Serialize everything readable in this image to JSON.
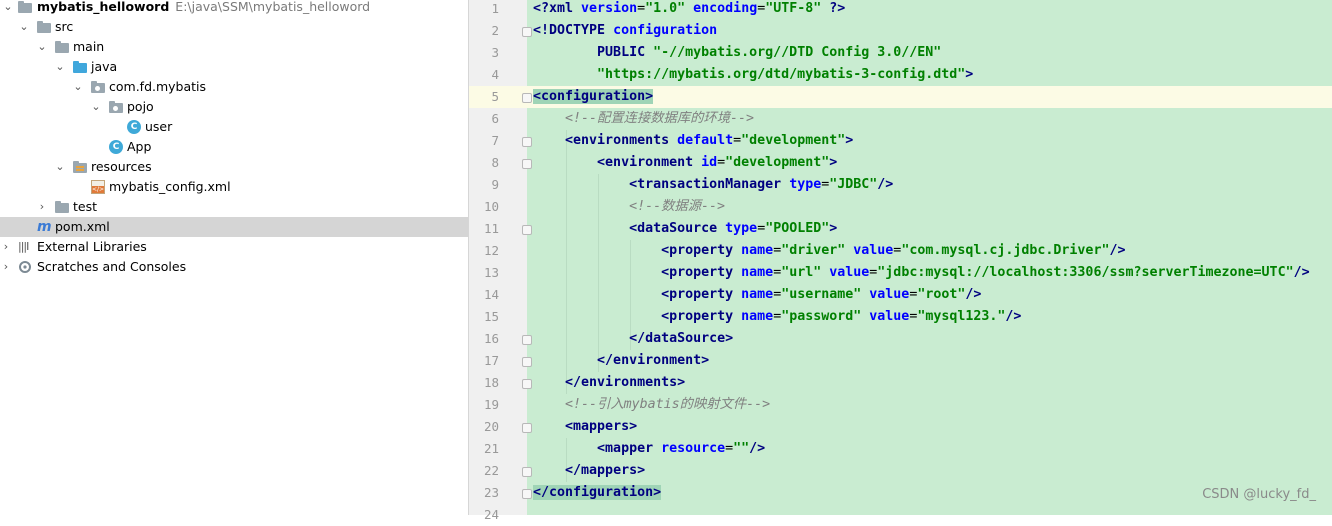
{
  "tree": {
    "project": {
      "name": "mybatis_helloword",
      "path": "E:\\java\\SSM\\mybatis_helloword"
    },
    "items": [
      {
        "label": "src"
      },
      {
        "label": "main"
      },
      {
        "label": "java"
      },
      {
        "label": "com.fd.mybatis"
      },
      {
        "label": "pojo"
      },
      {
        "label": "user"
      },
      {
        "label": "App"
      },
      {
        "label": "resources"
      },
      {
        "label": "mybatis_config.xml"
      },
      {
        "label": "test"
      },
      {
        "label": "pom.xml"
      },
      {
        "label": "External Libraries"
      },
      {
        "label": "Scratches and Consoles"
      }
    ],
    "icons": {
      "class": "C"
    }
  },
  "editor": {
    "line_numbers": [
      "1",
      "2",
      "3",
      "4",
      "5",
      "6",
      "7",
      "8",
      "9",
      "10",
      "11",
      "12",
      "13",
      "14",
      "15",
      "16",
      "17",
      "18",
      "19",
      "20",
      "21",
      "22",
      "23",
      "24"
    ],
    "lines": [
      [
        {
          "k": "t",
          "s": "<?xml "
        },
        {
          "k": "a",
          "s": "version"
        },
        {
          "k": "p",
          "s": "="
        },
        {
          "k": "v",
          "s": "\"1.0\""
        },
        {
          "k": "p",
          "s": " "
        },
        {
          "k": "a",
          "s": "encoding"
        },
        {
          "k": "p",
          "s": "="
        },
        {
          "k": "v",
          "s": "\"UTF-8\""
        },
        {
          "k": "t",
          "s": " ?>"
        }
      ],
      [
        {
          "k": "t",
          "s": "<!DOCTYPE "
        },
        {
          "k": "a",
          "s": "configuration"
        }
      ],
      [
        {
          "k": "p",
          "s": "        "
        },
        {
          "k": "t",
          "s": "PUBLIC "
        },
        {
          "k": "v",
          "s": "\"-//mybatis.org//DTD Config 3.0//EN\""
        }
      ],
      [
        {
          "k": "p",
          "s": "        "
        },
        {
          "k": "v",
          "s": "\"https://mybatis.org/dtd/mybatis-3-config.dtd\""
        },
        {
          "k": "t",
          "s": ">"
        }
      ],
      [
        {
          "k": "th",
          "s": "<configuration>"
        }
      ],
      [
        {
          "k": "p",
          "s": "    "
        },
        {
          "k": "c",
          "s": "<!--配置连接数据库的环境-->"
        }
      ],
      [
        {
          "k": "p",
          "s": "    "
        },
        {
          "k": "t",
          "s": "<environments "
        },
        {
          "k": "a",
          "s": "default"
        },
        {
          "k": "p",
          "s": "="
        },
        {
          "k": "v",
          "s": "\"development\""
        },
        {
          "k": "t",
          "s": ">"
        }
      ],
      [
        {
          "k": "p",
          "s": "        "
        },
        {
          "k": "t",
          "s": "<environment "
        },
        {
          "k": "a",
          "s": "id"
        },
        {
          "k": "p",
          "s": "="
        },
        {
          "k": "v",
          "s": "\"development\""
        },
        {
          "k": "t",
          "s": ">"
        }
      ],
      [
        {
          "k": "p",
          "s": "            "
        },
        {
          "k": "t",
          "s": "<transactionManager "
        },
        {
          "k": "a",
          "s": "type"
        },
        {
          "k": "p",
          "s": "="
        },
        {
          "k": "v",
          "s": "\"JDBC\""
        },
        {
          "k": "t",
          "s": "/>"
        }
      ],
      [
        {
          "k": "p",
          "s": "            "
        },
        {
          "k": "c",
          "s": "<!--数据源-->"
        }
      ],
      [
        {
          "k": "p",
          "s": "            "
        },
        {
          "k": "t",
          "s": "<dataSource "
        },
        {
          "k": "a",
          "s": "type"
        },
        {
          "k": "p",
          "s": "="
        },
        {
          "k": "v",
          "s": "\"POOLED\""
        },
        {
          "k": "t",
          "s": ">"
        }
      ],
      [
        {
          "k": "p",
          "s": "                "
        },
        {
          "k": "t",
          "s": "<property "
        },
        {
          "k": "a",
          "s": "name"
        },
        {
          "k": "p",
          "s": "="
        },
        {
          "k": "v",
          "s": "\"driver\""
        },
        {
          "k": "p",
          "s": " "
        },
        {
          "k": "a",
          "s": "value"
        },
        {
          "k": "p",
          "s": "="
        },
        {
          "k": "v",
          "s": "\"com.mysql.cj.jdbc.Driver\""
        },
        {
          "k": "t",
          "s": "/>"
        }
      ],
      [
        {
          "k": "p",
          "s": "                "
        },
        {
          "k": "t",
          "s": "<property "
        },
        {
          "k": "a",
          "s": "name"
        },
        {
          "k": "p",
          "s": "="
        },
        {
          "k": "v",
          "s": "\"url\""
        },
        {
          "k": "p",
          "s": " "
        },
        {
          "k": "a",
          "s": "value"
        },
        {
          "k": "p",
          "s": "="
        },
        {
          "k": "v",
          "s": "\"jdbc:mysql://localhost:3306/ssm?serverTimezone=UTC\""
        },
        {
          "k": "t",
          "s": "/>"
        }
      ],
      [
        {
          "k": "p",
          "s": "                "
        },
        {
          "k": "t",
          "s": "<property "
        },
        {
          "k": "a",
          "s": "name"
        },
        {
          "k": "p",
          "s": "="
        },
        {
          "k": "v",
          "s": "\"username\""
        },
        {
          "k": "p",
          "s": " "
        },
        {
          "k": "a",
          "s": "value"
        },
        {
          "k": "p",
          "s": "="
        },
        {
          "k": "v",
          "s": "\"root\""
        },
        {
          "k": "t",
          "s": "/>"
        }
      ],
      [
        {
          "k": "p",
          "s": "                "
        },
        {
          "k": "t",
          "s": "<property "
        },
        {
          "k": "a",
          "s": "name"
        },
        {
          "k": "p",
          "s": "="
        },
        {
          "k": "v",
          "s": "\"password\""
        },
        {
          "k": "p",
          "s": " "
        },
        {
          "k": "a",
          "s": "value"
        },
        {
          "k": "p",
          "s": "="
        },
        {
          "k": "v",
          "s": "\"mysql123.\""
        },
        {
          "k": "t",
          "s": "/>"
        }
      ],
      [
        {
          "k": "p",
          "s": "            "
        },
        {
          "k": "t",
          "s": "</dataSource>"
        }
      ],
      [
        {
          "k": "p",
          "s": "        "
        },
        {
          "k": "t",
          "s": "</environment>"
        }
      ],
      [
        {
          "k": "p",
          "s": "    "
        },
        {
          "k": "t",
          "s": "</environments>"
        }
      ],
      [
        {
          "k": "p",
          "s": "    "
        },
        {
          "k": "c",
          "s": "<!--引入mybatis的映射文件-->"
        }
      ],
      [
        {
          "k": "p",
          "s": "    "
        },
        {
          "k": "t",
          "s": "<mappers>"
        }
      ],
      [
        {
          "k": "p",
          "s": "        "
        },
        {
          "k": "t",
          "s": "<mapper "
        },
        {
          "k": "a",
          "s": "resource"
        },
        {
          "k": "p",
          "s": "="
        },
        {
          "k": "v",
          "s": "\"\""
        },
        {
          "k": "t",
          "s": "/>"
        }
      ],
      [
        {
          "k": "p",
          "s": "    "
        },
        {
          "k": "t",
          "s": "</mappers>"
        }
      ],
      [
        {
          "k": "th",
          "s": "</configuration>"
        }
      ]
    ]
  },
  "watermark": "CSDN @lucky_fd_"
}
